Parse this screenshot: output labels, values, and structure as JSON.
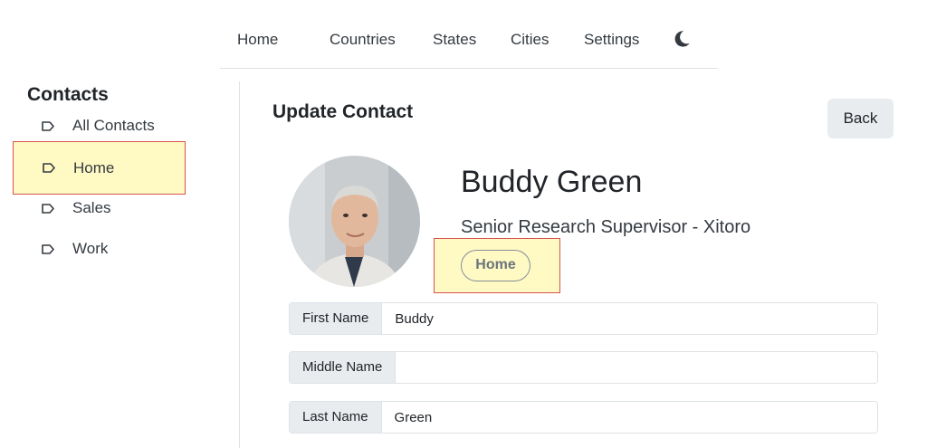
{
  "nav": {
    "items": [
      "Home",
      "Countries",
      "States",
      "Cities",
      "Settings"
    ],
    "theme_icon": "moon-icon"
  },
  "sidebar": {
    "title": "Contacts",
    "items": [
      {
        "label": "All Contacts",
        "icon": "tag-icon"
      },
      {
        "label": "Home",
        "icon": "tag-icon"
      },
      {
        "label": "Sales",
        "icon": "tag-icon"
      },
      {
        "label": "Work",
        "icon": "tag-icon"
      }
    ]
  },
  "main": {
    "title": "Update Contact",
    "back_label": "Back",
    "contact": {
      "name": "Buddy Green",
      "subtitle": "Senior Research Supervisor - Xitoro",
      "badge": "Home"
    },
    "fields": [
      {
        "label": "First Name",
        "value": "Buddy"
      },
      {
        "label": "Middle Name",
        "value": ""
      },
      {
        "label": "Last Name",
        "value": "Green"
      }
    ]
  },
  "colors": {
    "highlight": "#fff9c4",
    "highlight_border": "#d9534f",
    "button_bg": "#e9ecef"
  }
}
